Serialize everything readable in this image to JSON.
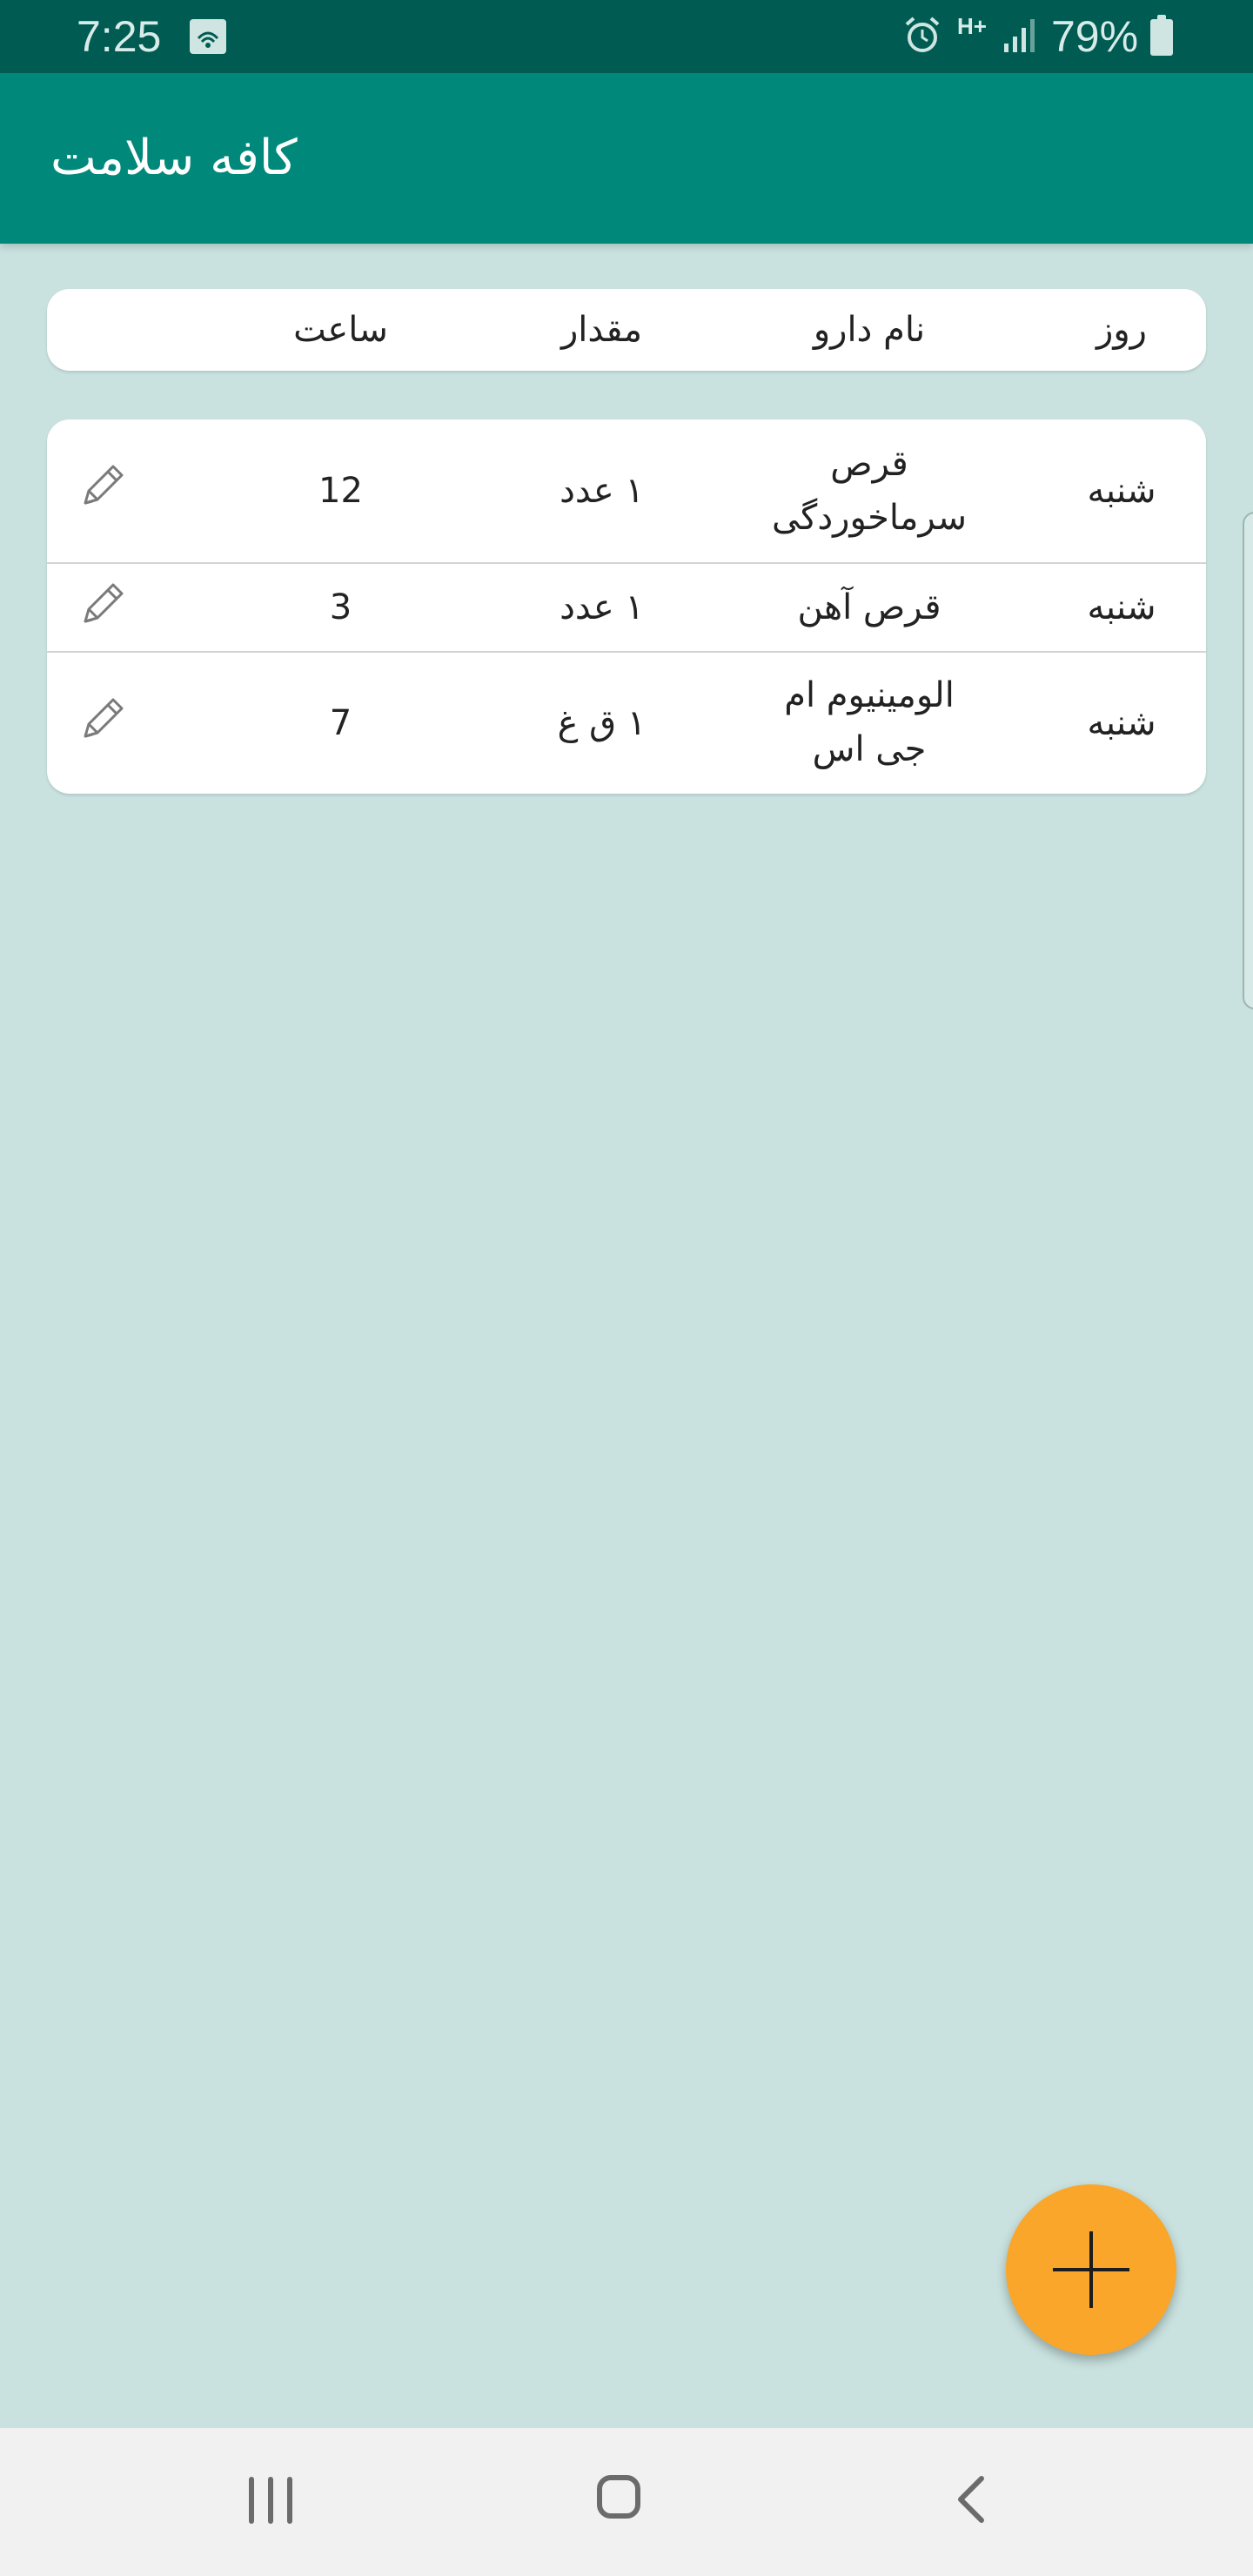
{
  "status_bar": {
    "time": "7:25",
    "network": "H+",
    "battery_percent": "79%"
  },
  "app_bar": {
    "title": "کافه سلامت"
  },
  "table": {
    "headers": {
      "day": "روز",
      "drug_name": "نام دارو",
      "amount": "مقدار",
      "time": "ساعت"
    },
    "rows": [
      {
        "day": "شنبه",
        "drug_name": "قرص سرماخوردگی",
        "amount": "۱ عدد",
        "time": "12"
      },
      {
        "day": "شنبه",
        "drug_name": "قرص آهن",
        "amount": "۱ عدد",
        "time": "3"
      },
      {
        "day": "شنبه",
        "drug_name": "الومینیوم ام جی اس",
        "amount": "۱ ق غ",
        "time": "7"
      }
    ]
  },
  "icons": {
    "edit": "pencil-icon",
    "add": "plus-icon",
    "nav_recents": "recents-icon",
    "nav_home": "home-icon",
    "nav_back": "back-icon"
  },
  "colors": {
    "status_bar": "#005c52",
    "app_bar": "#00897b",
    "background": "#c9e2df",
    "fab": "#faa62b"
  }
}
